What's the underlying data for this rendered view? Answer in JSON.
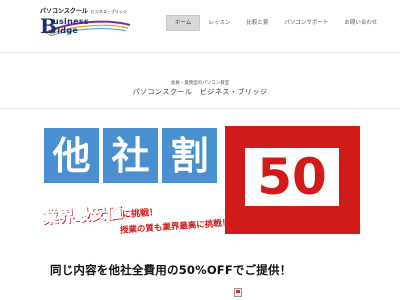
{
  "logo": {
    "top_text": "パソコンスクール",
    "top_small": "ビジネス・ブリッジ",
    "letter_b": "B",
    "word1": "usiness",
    "word2": "ridge"
  },
  "nav": {
    "items": [
      {
        "label": "ホーム",
        "active": true
      },
      {
        "label": "レッスン",
        "active": false
      },
      {
        "label": "比較と賞",
        "active": false
      },
      {
        "label": "パソコンサポート",
        "active": false
      },
      {
        "label": "お問い合わせ",
        "active": false
      }
    ]
  },
  "page": {
    "tagline": "会員・業務型のパソコン教室",
    "title": "パソコンスクール　ビジネス・ブリッジ"
  },
  "banner": {
    "tile1": "他",
    "tile2": "社",
    "tile3": "割",
    "number": "50",
    "headline_big": "業界最安値",
    "headline_small": "に挑戦！",
    "subheadline": "授業の質も業界最高に挑戦！",
    "bottom": "同じ内容を他社全費用の50%OFFでご提供！"
  },
  "colors": {
    "tile_blue": "#4a8fd0",
    "accent_red": "#d11a1a",
    "logo_navy": "#1b2f6e",
    "nav_active_bg": "#d8d8d8"
  }
}
